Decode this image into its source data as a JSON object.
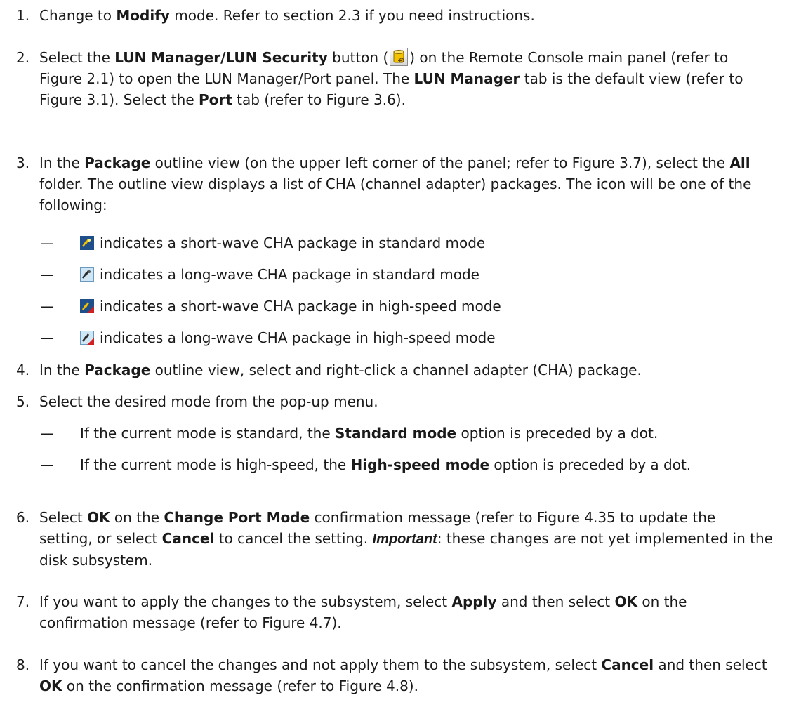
{
  "steps": [
    {
      "num": "1.",
      "p": [
        "Change to ",
        "Modify",
        " mode. Refer to section 2.3 if you need instructions."
      ]
    },
    {
      "num": "2.",
      "p": [
        "Select the ",
        "LUN Manager/LUN Security",
        " button (",
        ") on the Remote Console main panel (refer to Figure 2.1) to open the LUN Manager/Port panel. The ",
        "LUN Manager",
        " tab is the default view (refer to Figure 3.1). Select the ",
        "Port",
        " tab (refer to Figure 3.6)."
      ]
    },
    {
      "num": "3.",
      "p": [
        "In the ",
        "Package",
        " outline view (on the upper left corner of the panel; refer to Figure 3.7), select the ",
        "All",
        " folder. The outline view displays a list of CHA (channel adapter) packages. The icon will be one of the following:"
      ],
      "bullets": [
        {
          "icon": "short-wave-standard-icon",
          "text": "indicates a short-wave CHA package in standard mode"
        },
        {
          "icon": "long-wave-standard-icon",
          "text": "indicates a long-wave CHA package in standard mode"
        },
        {
          "icon": "short-wave-high-speed-icon",
          "text": "indicates a short-wave CHA package in high-speed mode"
        },
        {
          "icon": "long-wave-high-speed-icon",
          "text": "indicates a long-wave CHA package in high-speed mode"
        }
      ]
    },
    {
      "num": "4.",
      "p": [
        "In the ",
        "Package",
        " outline view, select and right-click a channel adapter (CHA) package."
      ]
    },
    {
      "num": "5.",
      "p": [
        "Select the desired mode from the pop-up menu."
      ],
      "bullets": [
        {
          "p": [
            "If the current mode is standard, the ",
            "Standard mode",
            " option is preceded by a dot."
          ]
        },
        {
          "p": [
            "If the current mode is high-speed, the ",
            "High-speed mode",
            " option is preceded by a dot."
          ]
        }
      ]
    },
    {
      "num": "6.",
      "p": [
        "Select ",
        "OK",
        " on the ",
        "Change Port Mode",
        " confirmation message (refer to Figure 4.35 to update the setting, or select ",
        "Cancel",
        " to cancel the setting. ",
        "Important",
        ": these changes are not yet implemented in the disk subsystem."
      ]
    },
    {
      "num": "7.",
      "p": [
        "If you want to apply the changes to the subsystem, select ",
        "Apply",
        " and then select ",
        "OK",
        " on the confirmation message (refer to Figure 4.7)."
      ]
    },
    {
      "num": "8.",
      "p": [
        "If you want to cancel the changes and not apply them to the subsystem, select ",
        "Cancel",
        " and then select ",
        "OK",
        " on the confirmation message (refer to Figure 4.8)."
      ]
    }
  ],
  "dash": "—",
  "colors": {
    "text": "#1a1a1a",
    "icon_yellow": "#f2c200",
    "icon_dark": "#2a2a2a",
    "icon_light": "#cfe6f5",
    "icon_red": "#d21f1f"
  }
}
